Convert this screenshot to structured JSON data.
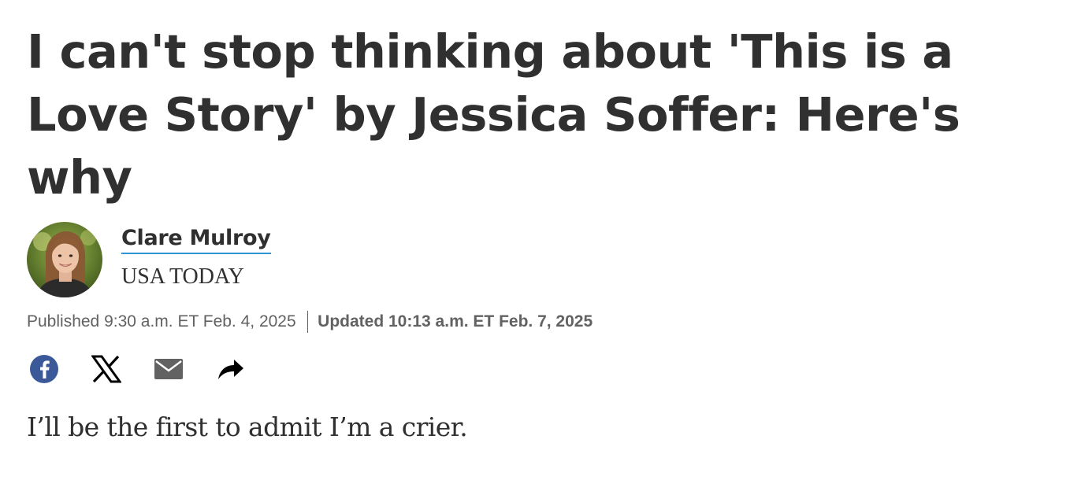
{
  "article": {
    "headline": "I can't stop thinking about 'This is a Love Story' by Jessica Soffer: Here's why",
    "author": {
      "name": "Clare Mulroy",
      "publication": "USA TODAY",
      "avatar": "author-photo"
    },
    "published": "Published 9:30 a.m. ET Feb. 4, 2025",
    "updated": "Updated 10:13 a.m. ET Feb. 7, 2025",
    "share": [
      {
        "icon": "facebook-icon",
        "color": "#3b5998"
      },
      {
        "icon": "x-icon",
        "color": "#000000"
      },
      {
        "icon": "email-icon",
        "color": "#626262"
      },
      {
        "icon": "share-arrow-icon",
        "color": "#000000"
      }
    ],
    "body_first_paragraph": "I’ll be the first to admit I’m a crier."
  },
  "colors": {
    "text": "#303030",
    "meta_text": "#626262",
    "author_underline": "#2f95d8",
    "background": "#ffffff"
  }
}
